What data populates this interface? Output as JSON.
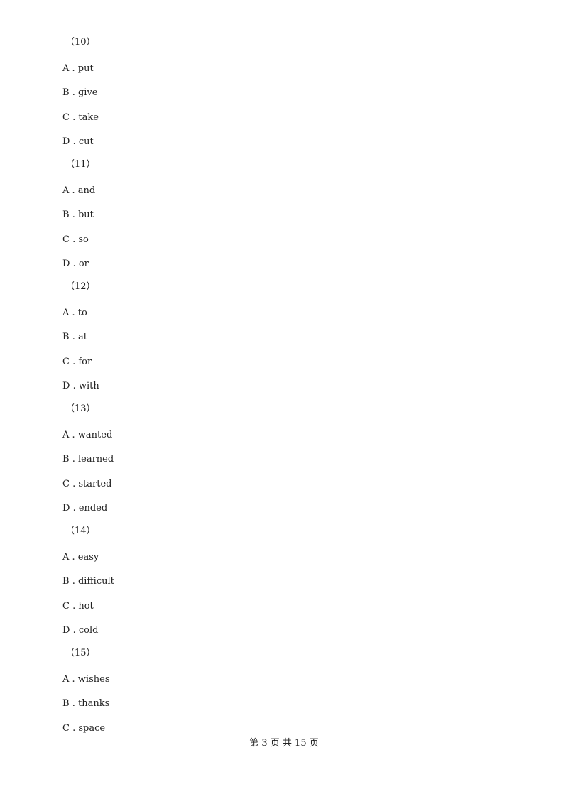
{
  "questions": [
    {
      "number": "（10）",
      "options": [
        {
          "letter": "A",
          "text": "put"
        },
        {
          "letter": "B",
          "text": "give"
        },
        {
          "letter": "C",
          "text": "take"
        },
        {
          "letter": "D",
          "text": "cut"
        }
      ]
    },
    {
      "number": "（11）",
      "options": [
        {
          "letter": "A",
          "text": "and"
        },
        {
          "letter": "B",
          "text": "but"
        },
        {
          "letter": "C",
          "text": "so"
        },
        {
          "letter": "D",
          "text": "or"
        }
      ]
    },
    {
      "number": "（12）",
      "options": [
        {
          "letter": "A",
          "text": "to"
        },
        {
          "letter": "B",
          "text": "at"
        },
        {
          "letter": "C",
          "text": "for"
        },
        {
          "letter": "D",
          "text": "with"
        }
      ]
    },
    {
      "number": "（13）",
      "options": [
        {
          "letter": "A",
          "text": "wanted"
        },
        {
          "letter": "B",
          "text": "learned"
        },
        {
          "letter": "C",
          "text": "started"
        },
        {
          "letter": "D",
          "text": "ended"
        }
      ]
    },
    {
      "number": "（14）",
      "options": [
        {
          "letter": "A",
          "text": "easy"
        },
        {
          "letter": "B",
          "text": "difficult"
        },
        {
          "letter": "C",
          "text": "hot"
        },
        {
          "letter": "D",
          "text": "cold"
        }
      ]
    },
    {
      "number": "（15）",
      "options": [
        {
          "letter": "A",
          "text": "wishes"
        },
        {
          "letter": "B",
          "text": "thanks"
        },
        {
          "letter": "C",
          "text": "space"
        }
      ]
    }
  ],
  "footer": {
    "text": "第 3 页 共 15 页"
  }
}
